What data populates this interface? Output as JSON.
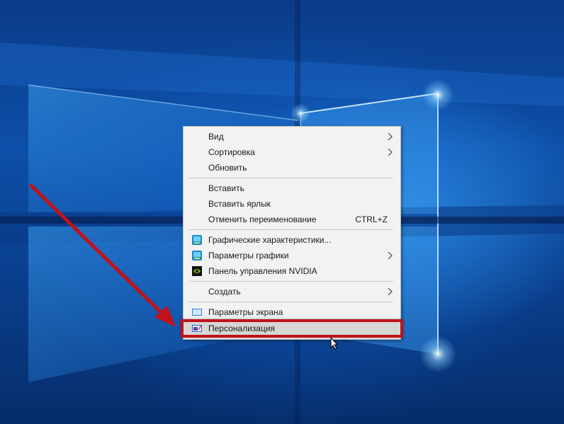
{
  "desktop": {
    "background_color": "#0b3b88",
    "glow_color": "#7fd0ff"
  },
  "context_menu": {
    "items": [
      {
        "label": "Вид",
        "submenu": true
      },
      {
        "label": "Сортировка",
        "submenu": true
      },
      {
        "label": "Обновить",
        "submenu": false
      },
      {
        "label": "Вставить",
        "submenu": false
      },
      {
        "label": "Вставить ярлык",
        "submenu": false
      },
      {
        "label": "Отменить переименование",
        "shortcut": "CTRL+Z",
        "submenu": false
      },
      {
        "label": "Графические характеристики...",
        "icon": "intel-graphics-icon",
        "submenu": false
      },
      {
        "label": "Параметры графики",
        "icon": "intel-graphics-icon",
        "submenu": true
      },
      {
        "label": "Панель управления NVIDIA",
        "icon": "nvidia-icon",
        "submenu": false
      },
      {
        "label": "Создать",
        "submenu": true
      },
      {
        "label": "Параметры экрана",
        "icon": "display-icon",
        "submenu": false
      },
      {
        "label": "Персонализация",
        "icon": "personalize-icon",
        "submenu": false,
        "highlighted": true
      }
    ]
  },
  "annotation": {
    "arrow_color": "#c0121a",
    "highlight_color": "#c0121a"
  }
}
